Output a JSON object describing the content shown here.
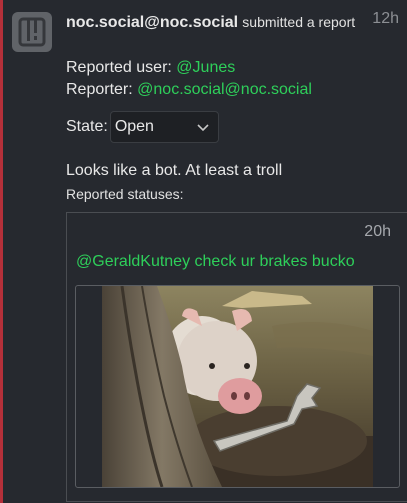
{
  "notification": {
    "actor": "noc.social@noc.social",
    "action": "submitted a report",
    "time": "12h",
    "reported_user_label": "Reported user:",
    "reported_user": "@Junes",
    "reporter_label": "Reporter:",
    "reporter": "@noc.social@noc.social",
    "state_label": "State:",
    "state_value": "Open",
    "comment": "Looks like a bot. At least a troll",
    "reported_statuses_label": "Reported statuses:"
  },
  "status": {
    "time": "20h",
    "text": "@GeraldKutney check ur brakes bucko"
  },
  "colors": {
    "accent": "#2ecf5a",
    "background": "#26292f",
    "alert": "#b4303a"
  }
}
